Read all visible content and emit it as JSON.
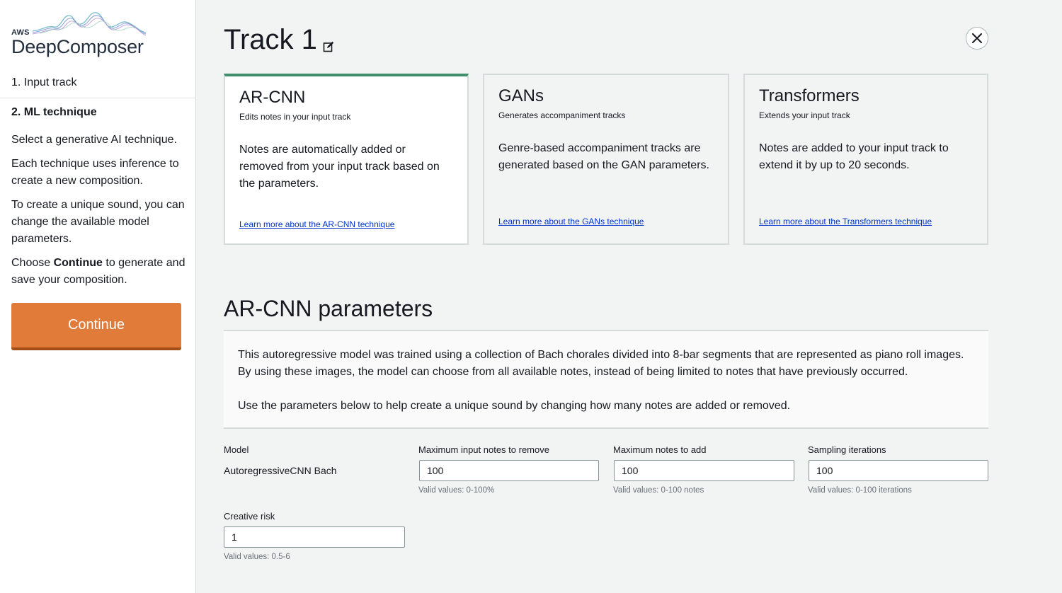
{
  "sidebar": {
    "brand_top": "AWS",
    "brand_name": "DeepComposer",
    "step1": "1. Input track",
    "step2": "2. ML technique",
    "para1": "Select a generative AI technique.",
    "para2": "Each technique uses inference to create a new composition.",
    "para3": "To create a unique sound, you can change the available model parameters.",
    "para4_pre": "Choose ",
    "para4_bold": "Continue",
    "para4_post": " to generate and save your composition.",
    "continue_label": "Continue"
  },
  "header": {
    "title": "Track 1"
  },
  "cards": [
    {
      "title": "AR-CNN",
      "subtitle": "Edits notes in your input track",
      "description": "Notes are automatically added or removed from your input track based on the parameters.",
      "link": "Learn more about the AR-CNN technique"
    },
    {
      "title": "GANs",
      "subtitle": "Generates accompaniment tracks",
      "description": "Genre-based accompaniment tracks are generated based on the GAN parameters.",
      "link": "Learn more about the GANs technique"
    },
    {
      "title": "Transformers",
      "subtitle": "Extends your input track",
      "description": "Notes are added to your input track to extend it by up to 20 seconds.",
      "link": "Learn more about the Transformers technique"
    }
  ],
  "params": {
    "title": "AR-CNN parameters",
    "info1": "This autoregressive model was trained using a collection of Bach chorales divided into 8-bar segments that are represented as piano roll images. By using these images, the model can choose from all available notes, instead of being limited to notes that have previously occurred.",
    "info2": "Use the parameters below to help create a unique sound by changing how many notes are added or removed.",
    "model_label": "Model",
    "model_value": "AutoregressiveCNN Bach",
    "remove_label": "Maximum input notes to remove",
    "remove_value": "100",
    "remove_hint": "Valid values: 0-100%",
    "add_label": "Maximum notes to add",
    "add_value": "100",
    "add_hint": "Valid values: 0-100 notes",
    "iter_label": "Sampling iterations",
    "iter_value": "100",
    "iter_hint": "Valid values: 0-100 iterations",
    "risk_label": "Creative risk",
    "risk_value": "1",
    "risk_hint": "Valid values: 0.5-6"
  },
  "colors": {
    "accent_orange": "#e07b39",
    "selected_green": "#3e8f6a",
    "link_blue": "#0033cc"
  }
}
